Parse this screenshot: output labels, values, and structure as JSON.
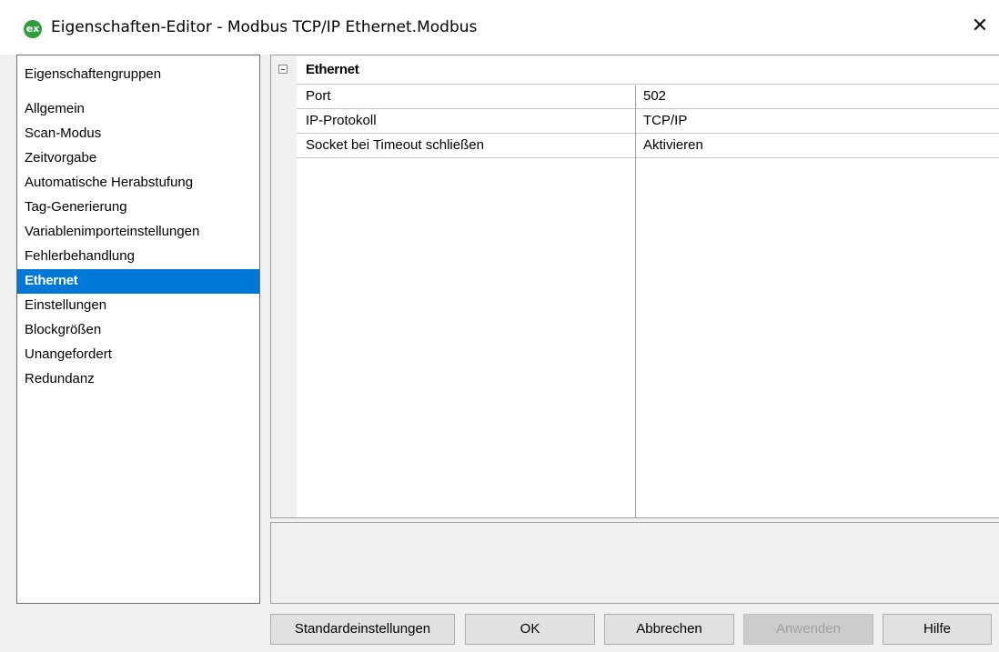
{
  "window": {
    "title": "Eigenschaften-Editor - Modbus TCP/IP Ethernet.Modbus",
    "icon_text": "ex",
    "icon_color": "#2e9e3e",
    "close_glyph": "✕"
  },
  "groups": {
    "header": "Eigenschaftengruppen",
    "items": [
      {
        "label": "Allgemein"
      },
      {
        "label": "Scan-Modus"
      },
      {
        "label": "Zeitvorgabe"
      },
      {
        "label": "Automatische Herabstufung"
      },
      {
        "label": "Tag-Generierung"
      },
      {
        "label": "Variablenimporteinstellungen"
      },
      {
        "label": "Fehlerbehandlung"
      },
      {
        "label": "Ethernet",
        "selected": true
      },
      {
        "label": "Einstellungen"
      },
      {
        "label": "Blockgrößen"
      },
      {
        "label": "Unangefordert"
      },
      {
        "label": "Redundanz"
      }
    ],
    "selected_color": "#0078d7"
  },
  "grid": {
    "category": "Ethernet",
    "properties": [
      {
        "name": "Port",
        "value": "502"
      },
      {
        "name": "IP-Protokoll",
        "value": "TCP/IP"
      },
      {
        "name": "Socket bei Timeout schließen",
        "value": "Aktivieren"
      }
    ]
  },
  "buttons": {
    "defaults": "Standardeinstellungen",
    "ok": "OK",
    "cancel": "Abbrechen",
    "apply": "Anwenden",
    "help": "Hilfe"
  }
}
